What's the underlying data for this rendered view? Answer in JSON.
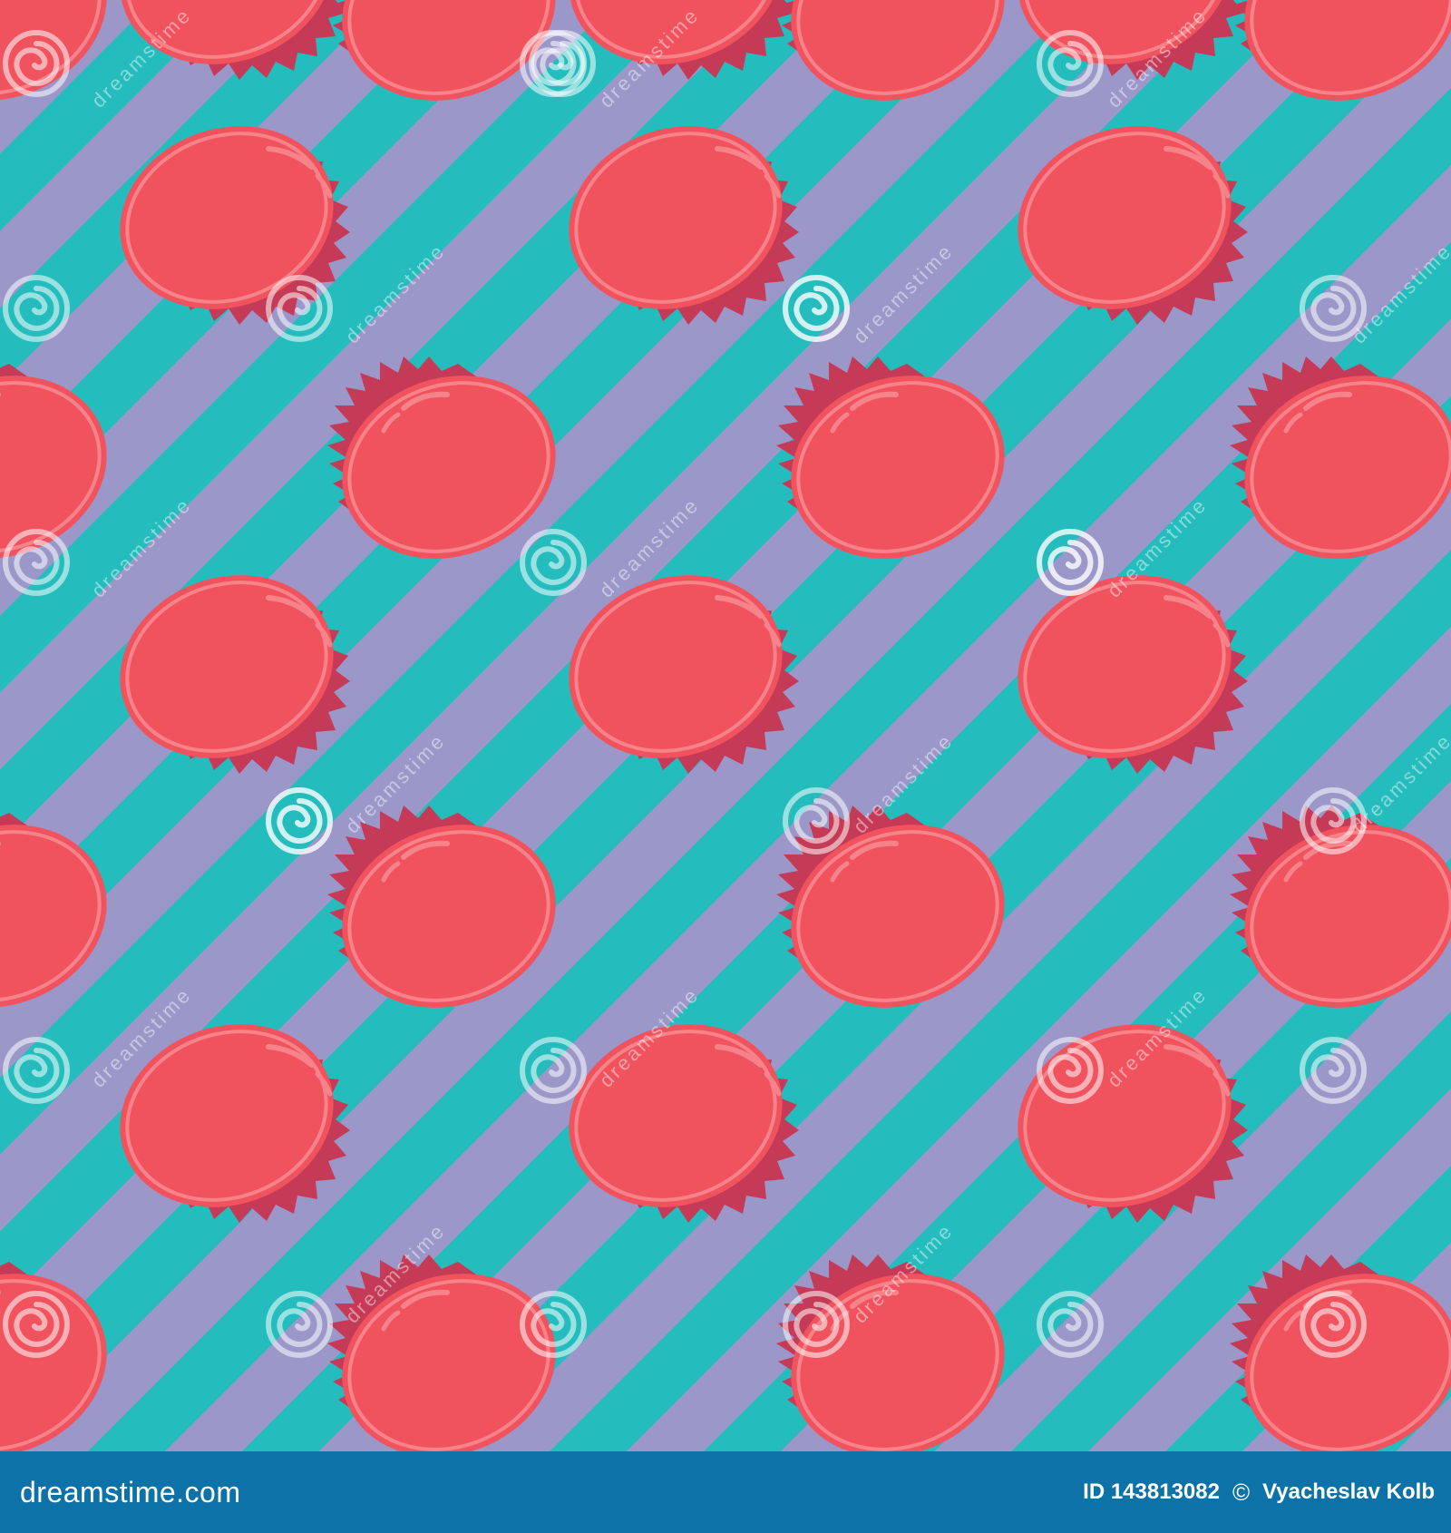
{
  "image": {
    "subject": "seamless pattern of red bottle caps on diagonal stripes",
    "icons": [
      "bottle-cap-icon",
      "watermark-spiral-icon"
    ],
    "colors": {
      "stripe_teal": "#25bcbd",
      "stripe_lavender": "#9b97c9",
      "cap_red": "#f0535e",
      "cap_shadow": "#c53a56",
      "cap_highlight": "#f7838a",
      "footer_bg": "#0d72a8"
    }
  },
  "watermark": {
    "text": "dreamstime"
  },
  "footer": {
    "brand": "dreamstime.com",
    "image_id": "ID 143813082",
    "copyright_symbol": "©",
    "author": "Vyacheslav Kolb"
  }
}
